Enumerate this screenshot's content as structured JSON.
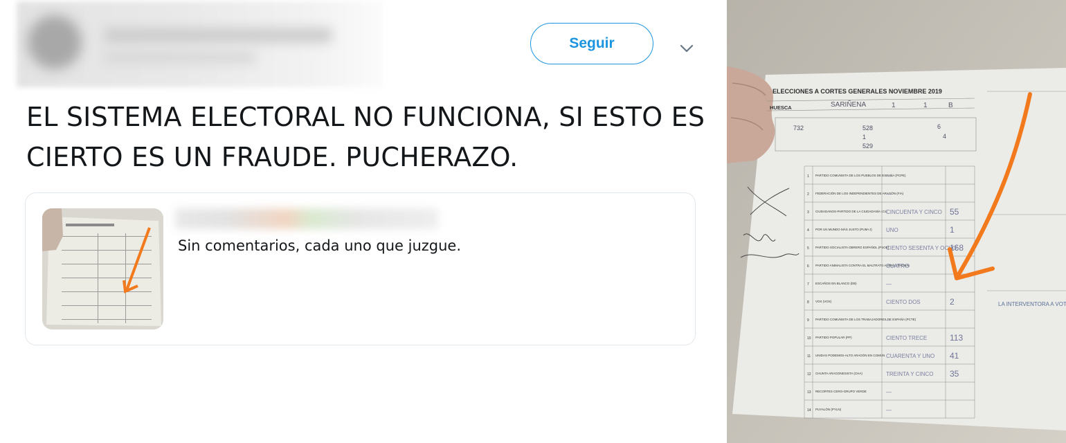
{
  "tweet": {
    "follow_label": "Seguir",
    "text": "EL SISTEMA ELECTORAL NO FUNCIONA, SI ESTO ES CIERTO ES UN FRAUDE. PUCHERAZO.",
    "quoted": {
      "text": "Sin comentarios, cada uno que juzgue."
    }
  },
  "photo": {
    "form_title": "ELECCIONES A CORTES GENERALES NOVIEMBRE 2019",
    "province": "HUESCA",
    "municipality": "SARIÑENA",
    "summary": [
      "732",
      "528",
      "6",
      "1",
      "4",
      "529"
    ],
    "rows": [
      {
        "n": "1",
        "party": "PARTIDO COMUNISTA DE LOS PUEBLOS DE ESPAÑA (PCPE)",
        "words": "—",
        "num": ""
      },
      {
        "n": "2",
        "party": "FEDERACIÓN DE LOS INDEPENDIENTES DE ARAGÓN (FIA)",
        "words": "—",
        "num": ""
      },
      {
        "n": "3",
        "party": "CIUDADANOS-PARTIDO DE LA CIUDADANÍA (Cs)",
        "words": "CINCUENTA Y CINCO",
        "num": "55"
      },
      {
        "n": "4",
        "party": "POR UN MUNDO MÁS JUSTO (PUM+J)",
        "words": "UNO",
        "num": "1"
      },
      {
        "n": "5",
        "party": "PARTIDO SOCIALISTA OBRERO ESPAÑOL (PSOE)",
        "words": "CIENTO SESENTA Y OCHO",
        "num": "168"
      },
      {
        "n": "6",
        "party": "PARTIDO ANIMALISTA CONTRA EL MALTRATO ANIMAL (PACMA)",
        "words": "CUATRO",
        "num": ""
      },
      {
        "n": "7",
        "party": "ESCAÑOS EN BLANCO (EB)",
        "words": "—",
        "num": ""
      },
      {
        "n": "8",
        "party": "VOX (VOX)",
        "words": "CIENTO DOS",
        "num": "2"
      },
      {
        "n": "9",
        "party": "PARTIDO COMUNISTA DE LOS TRABAJADORES DE ESPAÑA (PCTE)",
        "words": "—",
        "num": ""
      },
      {
        "n": "10",
        "party": "PARTIDO POPULAR (PP)",
        "words": "CIENTO TRECE",
        "num": "113"
      },
      {
        "n": "11",
        "party": "UNIDAS PODEMOS-ALTO ARAGÓN EN COMÚN",
        "words": "CUARENTA Y UNO",
        "num": "41"
      },
      {
        "n": "12",
        "party": "CHUNTA ARAGONESISTA (CHA)",
        "words": "TREINTA Y CINCO",
        "num": "35"
      },
      {
        "n": "13",
        "party": "RECORTES CERO-GRUPO VERDE",
        "words": "—",
        "num": ""
      },
      {
        "n": "14",
        "party": "PUYALÓN (PYLN)",
        "words": "—",
        "num": ""
      }
    ],
    "side_note": "LA INTERVENTORA A VOTADO POR ...",
    "arrow_color": "#f27a1c"
  }
}
